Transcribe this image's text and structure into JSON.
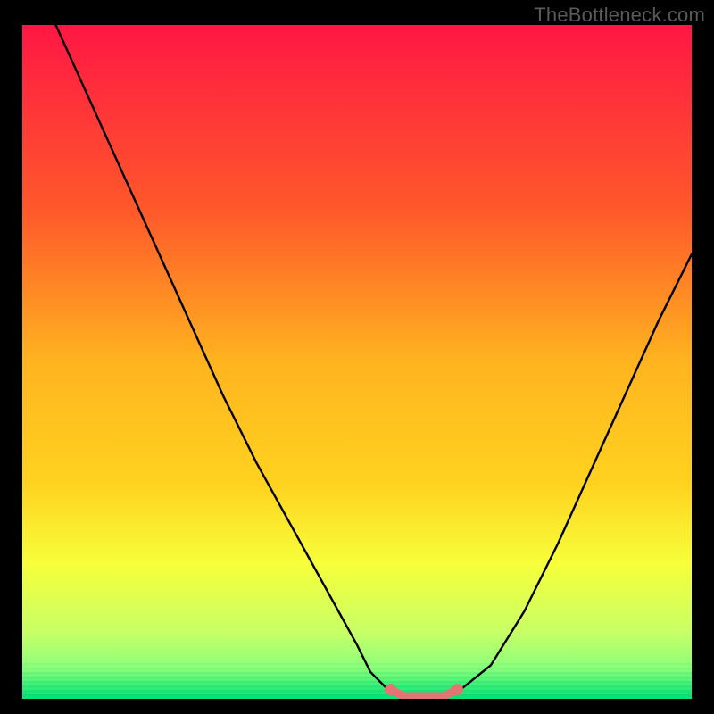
{
  "watermark": "TheBottleneck.com",
  "colors": {
    "bg": "#000000",
    "grad_top": "#ff1744",
    "grad_mid1": "#ff7b1f",
    "grad_mid2": "#ffd21f",
    "grad_mid3": "#f7ff3a",
    "grad_mid4": "#d4ff5a",
    "grad_bottom": "#00e676",
    "curve": "#000000",
    "marker": "#e57373"
  },
  "chart_data": {
    "type": "line",
    "title": "",
    "xlabel": "",
    "ylabel": "",
    "xlim": [
      0,
      100
    ],
    "ylim": [
      0,
      100
    ],
    "series": [
      {
        "name": "bottleneck-curve",
        "x": [
          5,
          10,
          15,
          20,
          25,
          30,
          35,
          40,
          45,
          50,
          52,
          55,
          58,
          60,
          62,
          65,
          70,
          75,
          80,
          85,
          90,
          95,
          100
        ],
        "values": [
          100,
          89,
          78,
          67,
          56,
          45,
          35,
          26,
          17,
          8,
          4,
          1,
          0,
          0,
          0,
          1,
          5,
          13,
          23,
          34,
          45,
          56,
          66
        ]
      },
      {
        "name": "optimal-band",
        "x": [
          55,
          57,
          60,
          63,
          65
        ],
        "values": [
          1,
          0,
          0,
          0,
          1
        ]
      }
    ]
  }
}
